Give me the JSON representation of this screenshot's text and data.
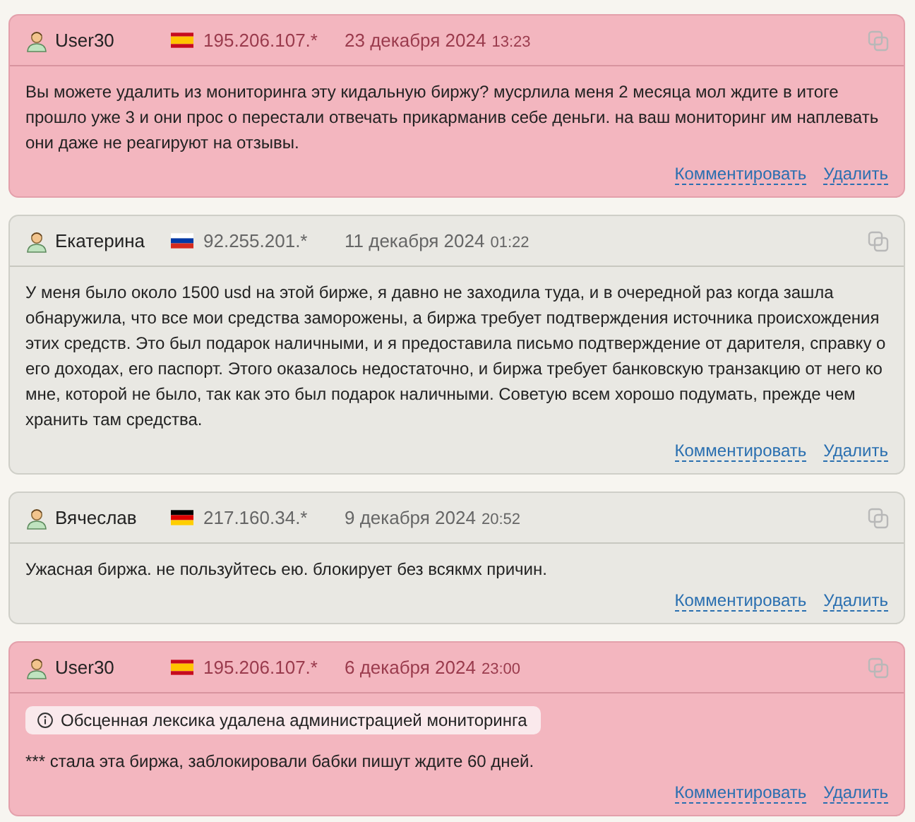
{
  "reviews": [
    {
      "highlighted": true,
      "author": "User30",
      "flag": {
        "kind": "es"
      },
      "ip": "195.206.107.*",
      "date": "23 декабря 2024",
      "time": "13:23",
      "text": "Вы можете удалить из мониторинга эту кидальную биржу? мусрлила меня 2 месяца мол ждите в итоге прошло уже 3 и они прос о перестали отвечать прикарманив себе деньги. на ваш мониторинг им наплевать они даже не реагируют на отзывы.",
      "actions": [
        "Комментировать",
        "Удалить"
      ]
    },
    {
      "highlighted": false,
      "author": "Екатерина",
      "flag": {
        "kind": "ru"
      },
      "ip": "92.255.201.*",
      "date": "11 декабря 2024",
      "time": "01:22",
      "text": "У меня было около 1500 usd на этой бирже, я давно не заходила туда, и в очередной раз когда зашла обнаружила, что все мои средства заморожены, а биржа требует подтверждения источника происхождения этих средств. Это был подарок наличными, и я предоставила письмо подтверждение от дарителя, справку о его доходах, его паспорт. Этого оказалось недостаточно, и биржа требует банковскую транзакцию от него ко мне, которой не было, так как это был подарок наличными. Советую всем хорошо подумать, прежде чем хранить там средства.",
      "actions": [
        "Комментировать",
        "Удалить"
      ]
    },
    {
      "highlighted": false,
      "author": "Вячеслав",
      "flag": {
        "kind": "de"
      },
      "ip": "217.160.34.*",
      "date": "9 декабря 2024",
      "time": "20:52",
      "text": "Ужасная биржа. не пользуйтесь ею. блокирует без всякмх причин.",
      "actions": [
        "Комментировать",
        "Удалить"
      ]
    },
    {
      "highlighted": true,
      "author": "User30",
      "flag": {
        "kind": "es"
      },
      "ip": "195.206.107.*",
      "date": "6 декабря 2024",
      "time": "23:00",
      "notice": "Обсценная лексика удалена администрацией мониторинга",
      "text": "*** стала эта биржа, заблокировали бабки пишут ждите 60 дней.",
      "actions": [
        "Комментировать",
        "Удалить"
      ]
    }
  ]
}
